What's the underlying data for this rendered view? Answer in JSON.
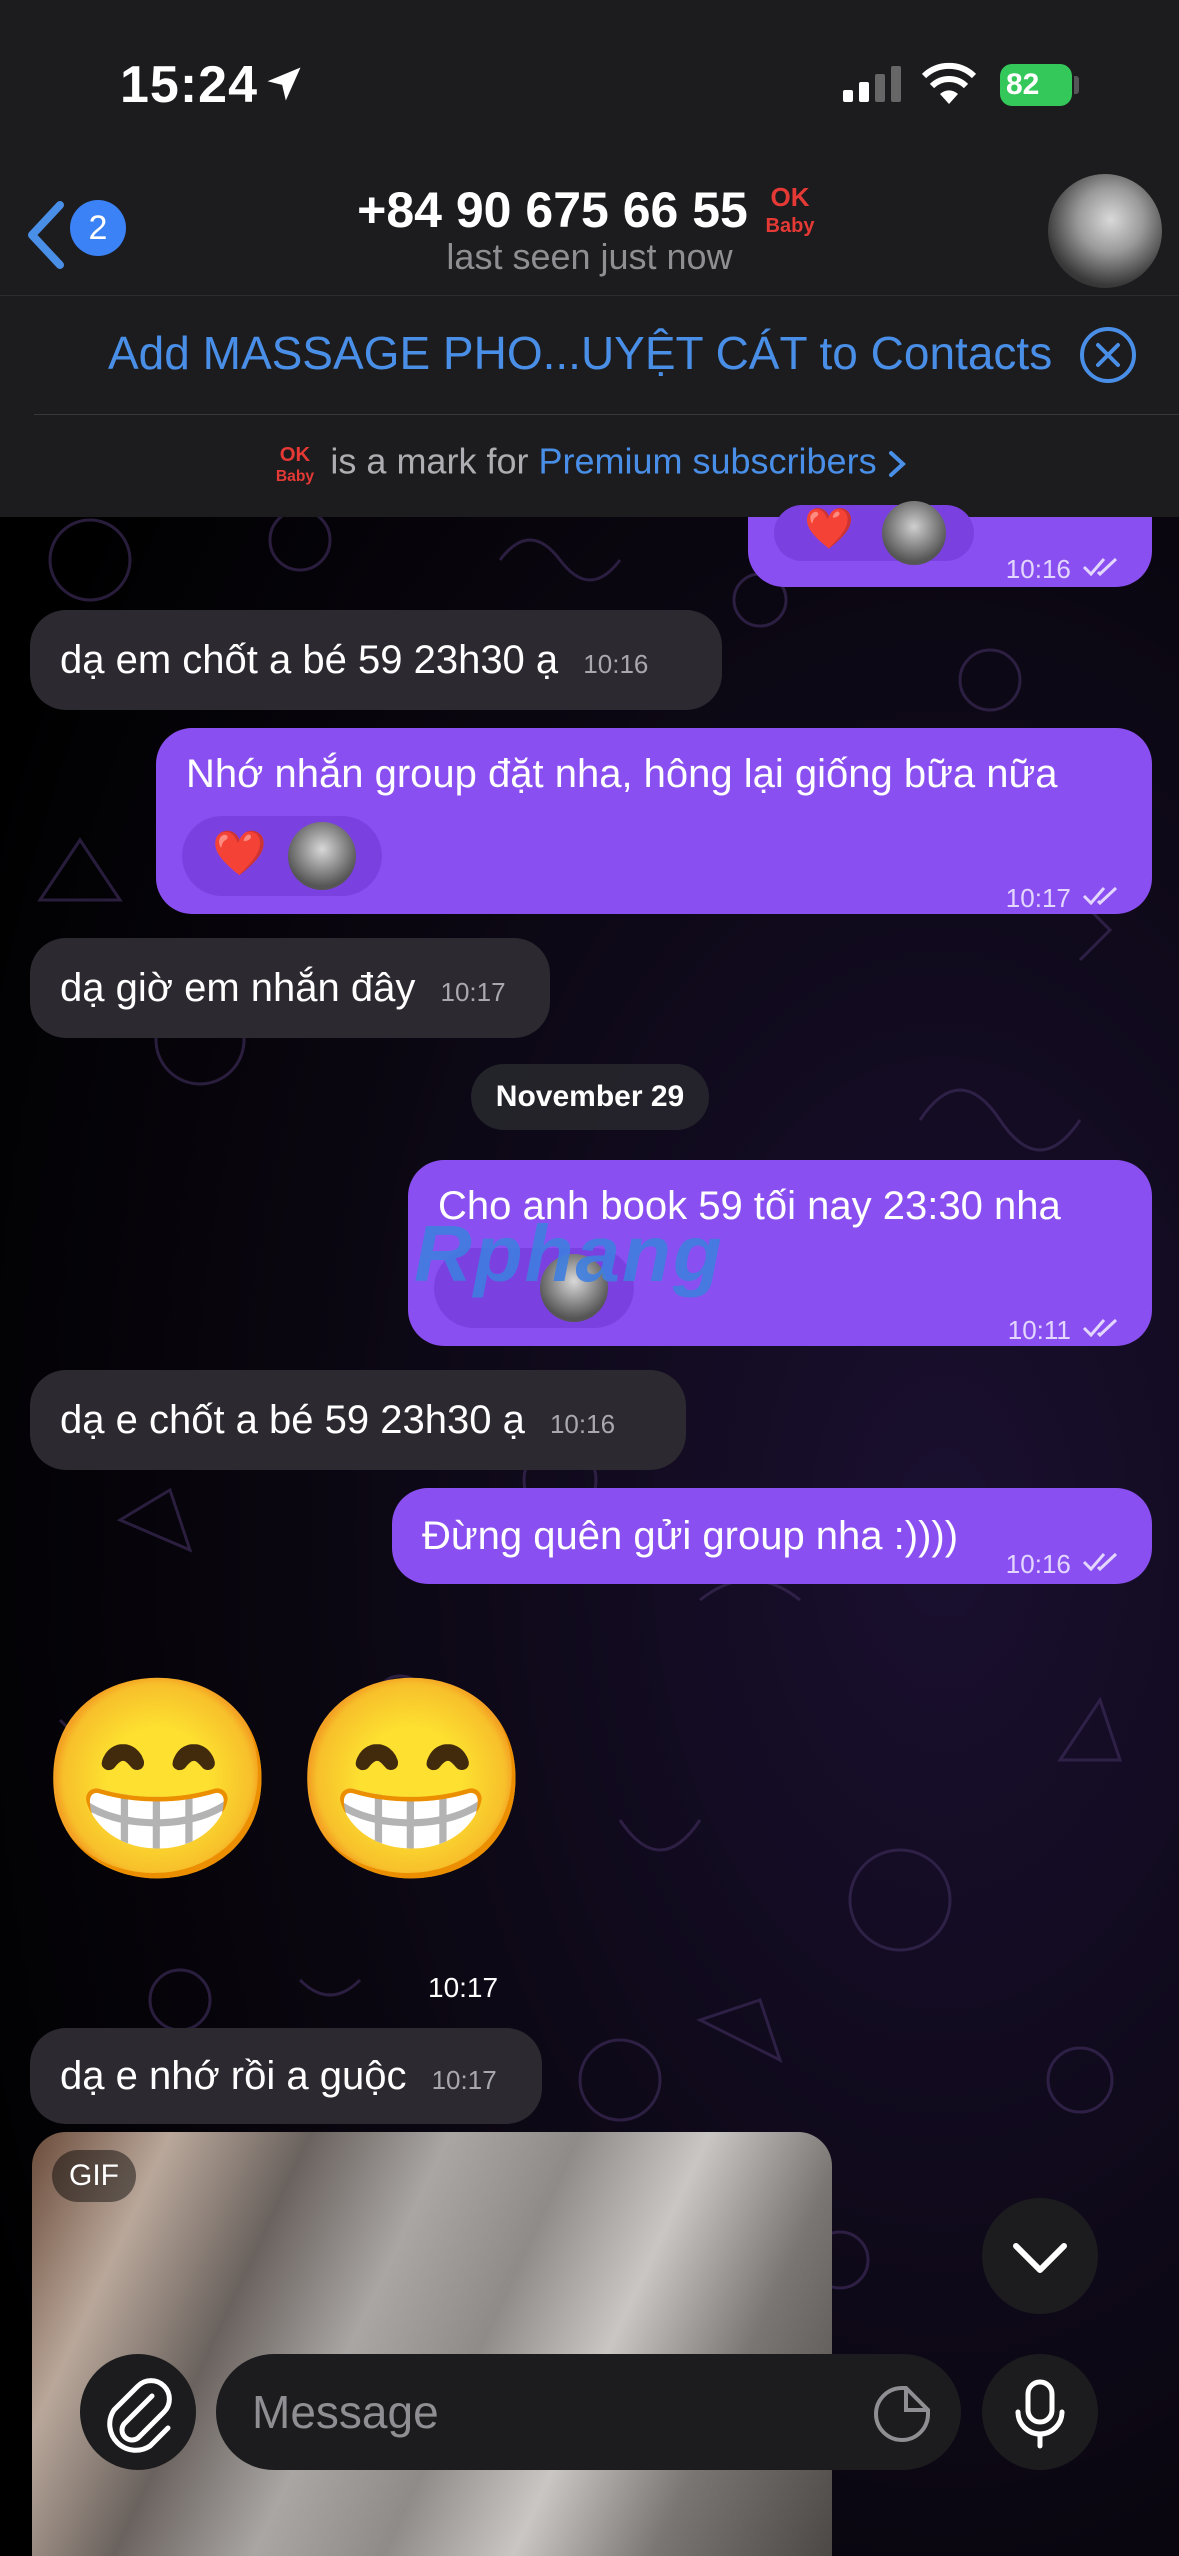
{
  "status_bar": {
    "time": "15:24",
    "battery": "82"
  },
  "header": {
    "back_count": "2",
    "title": "+84 90 675 66 55",
    "subtitle": "last seen just now"
  },
  "banners": {
    "add_contact": "Add MASSAGE PHO...UYỆT CÁT to Contacts",
    "premium_prefix": "is a mark for",
    "premium_link": "Premium subscribers",
    "badge_text": "OK Baby"
  },
  "messages": {
    "m0_time": "10:16",
    "m1_text": "dạ em chốt a bé 59 23h30 ạ",
    "m1_time": "10:16",
    "m2_text": "Nhớ nhắn group đặt nha, hông lại giống bữa nữa",
    "m2_time": "10:17",
    "m3_text": "dạ giờ em nhắn đây",
    "m3_time": "10:17",
    "date_separator": "November 29",
    "m4_text": "Cho anh book 59 tối nay 23:30 nha",
    "m4_time": "10:11",
    "watermark": "Rphang",
    "m5_text": "dạ e chốt a bé 59 23h30 ạ",
    "m5_time": "10:16",
    "m6_text": "Đừng quên gửi group nha :))))",
    "m6_time": "10:16",
    "sticker_emoji_1": "😁",
    "sticker_emoji_2": "😁",
    "sticker_time": "10:17",
    "m7_text": "dạ e nhớ rồi a guộc",
    "m7_time": "10:17",
    "gif_label": "GIF",
    "reaction_heart": "❤️"
  },
  "composer": {
    "placeholder": "Message"
  },
  "colors": {
    "accent": "#4a8fe7",
    "outgoing_bubble": "#8a4ff0",
    "incoming_bubble": "#2c2a30"
  }
}
